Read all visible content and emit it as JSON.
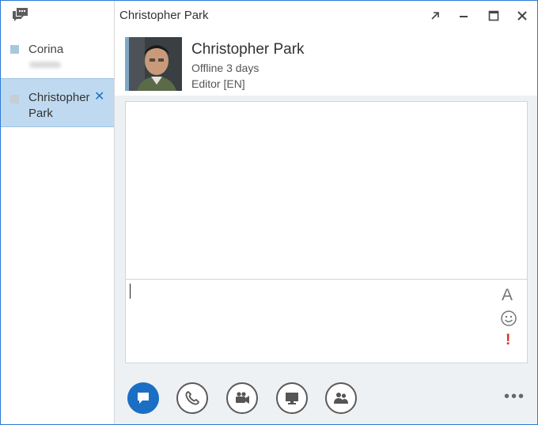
{
  "window": {
    "title": "Christopher Park"
  },
  "conversations": [
    {
      "name": "Corina",
      "presence_color": "#a8c8de",
      "selected": false
    },
    {
      "name": "Christopher Park",
      "presence_color": "#c5ced6",
      "selected": true,
      "close_glyph": "✕"
    }
  ],
  "contact": {
    "name": "Christopher Park",
    "status": "Offline 3 days",
    "note": "Editor [EN]"
  },
  "compose": {
    "font_glyph": "A",
    "important_glyph": "!"
  },
  "toolbar": {
    "buttons": [
      "im-icon",
      "phone-icon",
      "video-icon",
      "present-icon",
      "people-icon"
    ],
    "active": "im-icon",
    "more_glyph": "•••"
  },
  "colors": {
    "accent": "#1a6fc4",
    "selected_bg": "#bfdaf0",
    "important": "#d93025"
  }
}
